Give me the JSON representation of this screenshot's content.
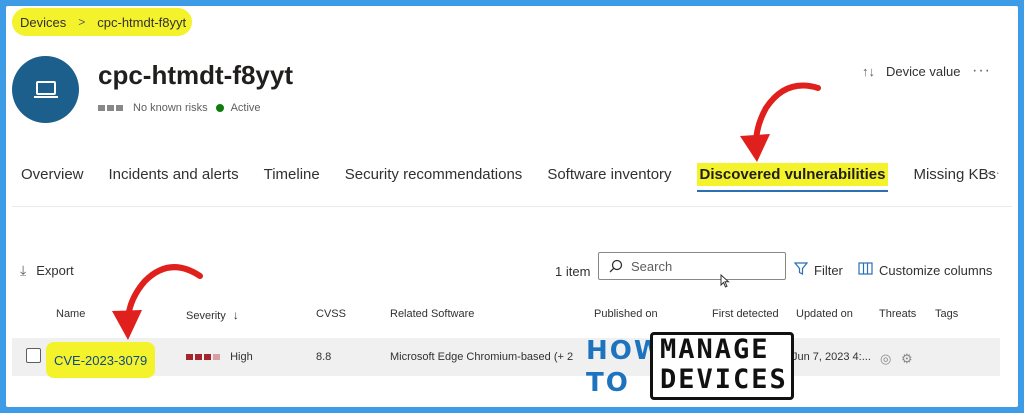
{
  "breadcrumb": {
    "root": "Devices",
    "current": "cpc-htmdt-f8yyt"
  },
  "device": {
    "name": "cpc-htmdt-f8yyt",
    "risk": "No known risks",
    "status": "Active",
    "device_value_label": "Device value",
    "more": "···"
  },
  "tabs": [
    {
      "label": "Overview"
    },
    {
      "label": "Incidents and alerts"
    },
    {
      "label": "Timeline"
    },
    {
      "label": "Security recommendations"
    },
    {
      "label": "Software inventory"
    },
    {
      "label": "Discovered vulnerabilities",
      "active": true
    },
    {
      "label": "Missing KBs"
    }
  ],
  "tabs_more": "···",
  "toolbar": {
    "export": "Export",
    "count": "1 item",
    "search_placeholder": "Search",
    "filter": "Filter",
    "customize": "Customize columns"
  },
  "table": {
    "headers": {
      "name": "Name",
      "severity": "Severity",
      "cvss": "CVSS",
      "related_software": "Related Software",
      "published_on": "Published on",
      "first_detected": "First detected",
      "updated_on": "Updated on",
      "threats": "Threats",
      "tags": "Tags"
    },
    "rows": [
      {
        "name": "CVE-2023-3079",
        "severity": "High",
        "cvss": "8.8",
        "related_software": "Microsoft Edge Chromium-based (+ 2",
        "updated_on": "Jun 7, 2023 4:..."
      }
    ]
  },
  "watermark": {
    "how": "HOW",
    "to": "TO",
    "manage": "MANAGE",
    "devices": "DEVICES"
  },
  "colors": {
    "highlight": "#f4f22a",
    "accent": "#2b6fb5",
    "severity_high": "#a4262c",
    "arrow": "#e0201c",
    "frame": "#3e9be6"
  }
}
